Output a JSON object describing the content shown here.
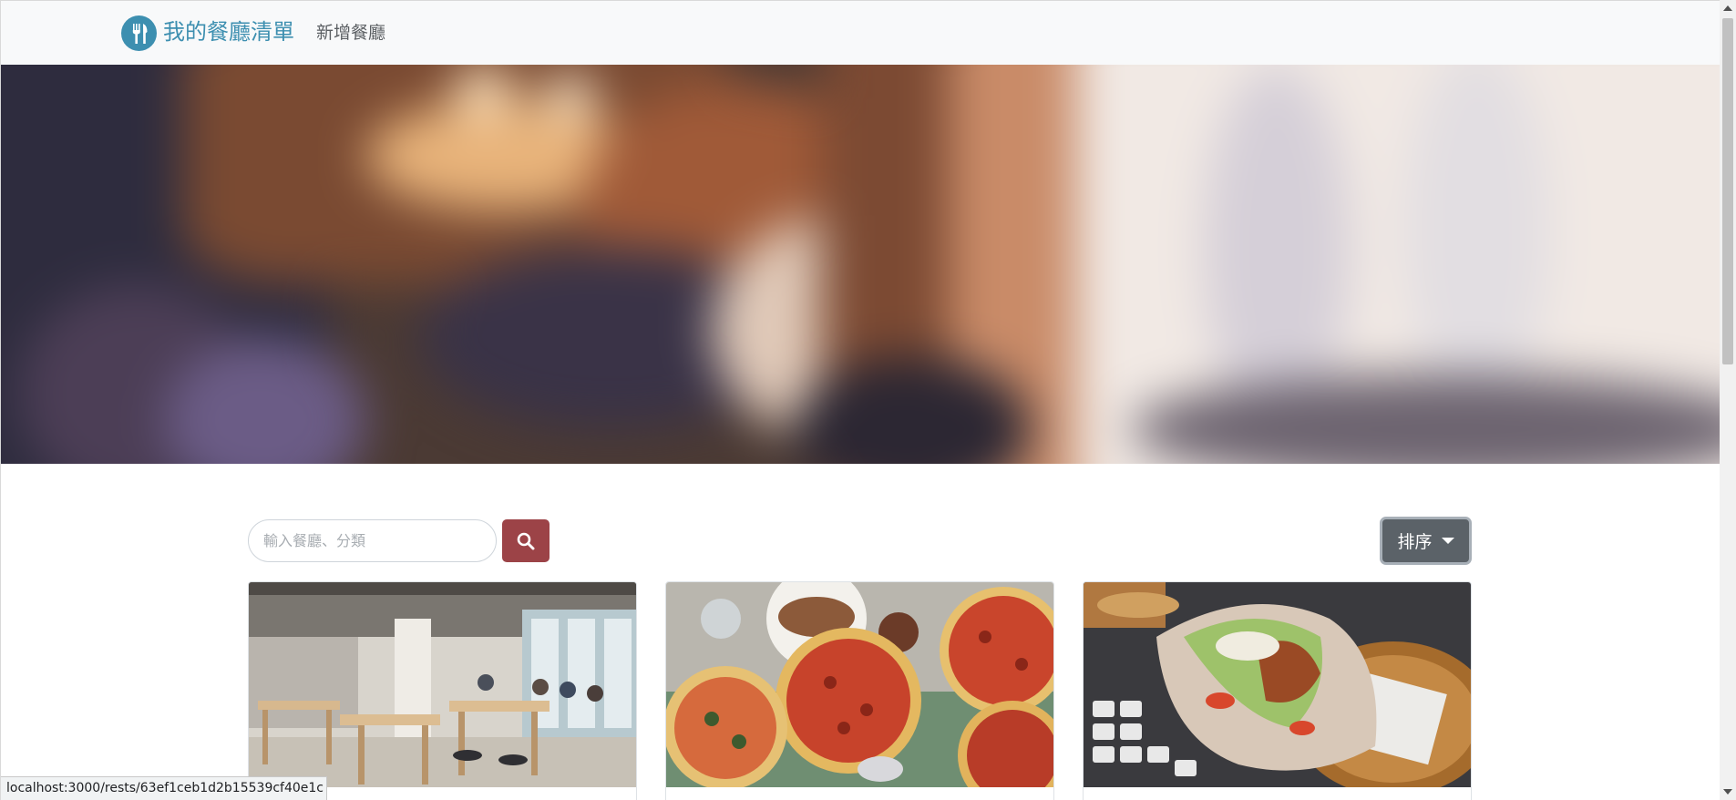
{
  "navbar": {
    "brand_icon": "utensils-icon",
    "brand_title": "我的餐廳清單",
    "nav_link_label": "新增餐廳"
  },
  "hero": {
    "image_description": "blurred-restaurant-interior"
  },
  "search": {
    "placeholder": "輸入餐廳、分類",
    "value": "",
    "button_icon": "search-icon"
  },
  "sort": {
    "label": "排序",
    "icon": "caret-down-icon"
  },
  "restaurants": [
    {
      "image": "cafe-interior"
    },
    {
      "image": "pizzas"
    },
    {
      "image": "kebab-wrap"
    }
  ],
  "status_bar": {
    "url": "localhost:3000/rests/63ef1ceb1d2b15539cf40e1c"
  },
  "colors": {
    "brand": "#3d8fb0",
    "search_button": "#9c4347",
    "sort_button": "#5b6268",
    "navbar_bg": "#f8f9fa"
  }
}
